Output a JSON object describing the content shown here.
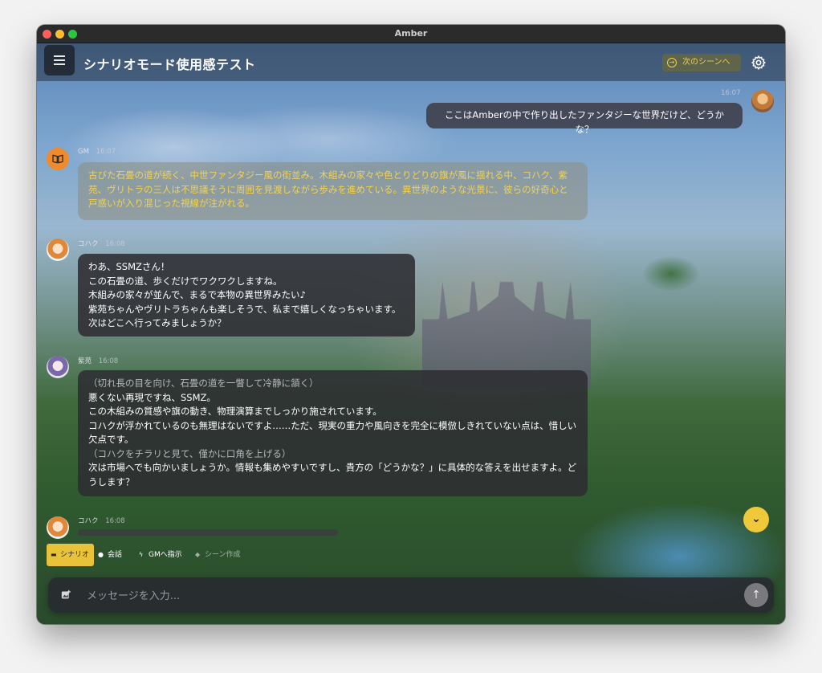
{
  "window": {
    "title": "Amber"
  },
  "header": {
    "title": "シナリオモード使用感テスト",
    "next_scene_label": "次のシーンへ"
  },
  "messages": {
    "user": {
      "time": "16:07",
      "text": "ここはAmberの中で作り出したファンタジーな世界だけど、どうかな？"
    },
    "narration": {
      "name": "GM",
      "time": "16:07",
      "text": "古びた石畳の道が続く、中世ファンタジー風の街並み。木組みの家々や色とりどりの旗が風に揺れる中、コハク、紫苑、ヴリトラの三人は不思議そうに周囲を見渡しながら歩みを進めている。異世界のような光景に、彼らの好奇心と戸惑いが入り混じった視線が注がれる。"
    },
    "kohaku": {
      "name": "コハク",
      "time": "16:08",
      "lines": [
        "わあ、SSMZさん！",
        "この石畳の道、歩くだけでワクワクしますね。",
        "木組みの家々が並んで、まるで本物の異世界みたい♪",
        "紫苑ちゃんやヴリトラちゃんも楽しそうで、私まで嬉しくなっちゃいます。",
        "次はどこへ行ってみましょうか？"
      ]
    },
    "shion": {
      "name": "紫苑",
      "time": "16:08",
      "lines": [
        "（切れ長の目を向け、石畳の道を一瞥して冷静に頷く）",
        "悪くない再現ですね、SSMZ。",
        "この木組みの質感や旗の動き、物理演算までしっかり施されています。",
        "コハクが浮かれているのも無理はないですよ……ただ、現実の重力や風向きを完全に模倣しきれていない点は、惜しい欠点です。",
        "（コハクをチラリと見て、僅かに口角を上げる）",
        "次は市場へでも向かいましょうか。情報も集めやすいですし、貴方の「どうかな？」に具体的な答えを出せますよ。どうします？"
      ]
    },
    "kohaku_typing": {
      "name": "コハク",
      "time": "16:08"
    }
  },
  "modes": [
    {
      "label": "シナリオ",
      "icon": "clapper-icon"
    },
    {
      "label": "会話",
      "icon": "speech-bubble-icon"
    },
    {
      "label": "GMへ指示",
      "icon": "bolt-icon"
    },
    {
      "label": "シーン作成",
      "icon": "scene-icon"
    }
  ],
  "composer": {
    "placeholder": "メッセージを入力..."
  },
  "colors": {
    "accent": "#f0c93a",
    "narration_text": "#f4d24e"
  }
}
